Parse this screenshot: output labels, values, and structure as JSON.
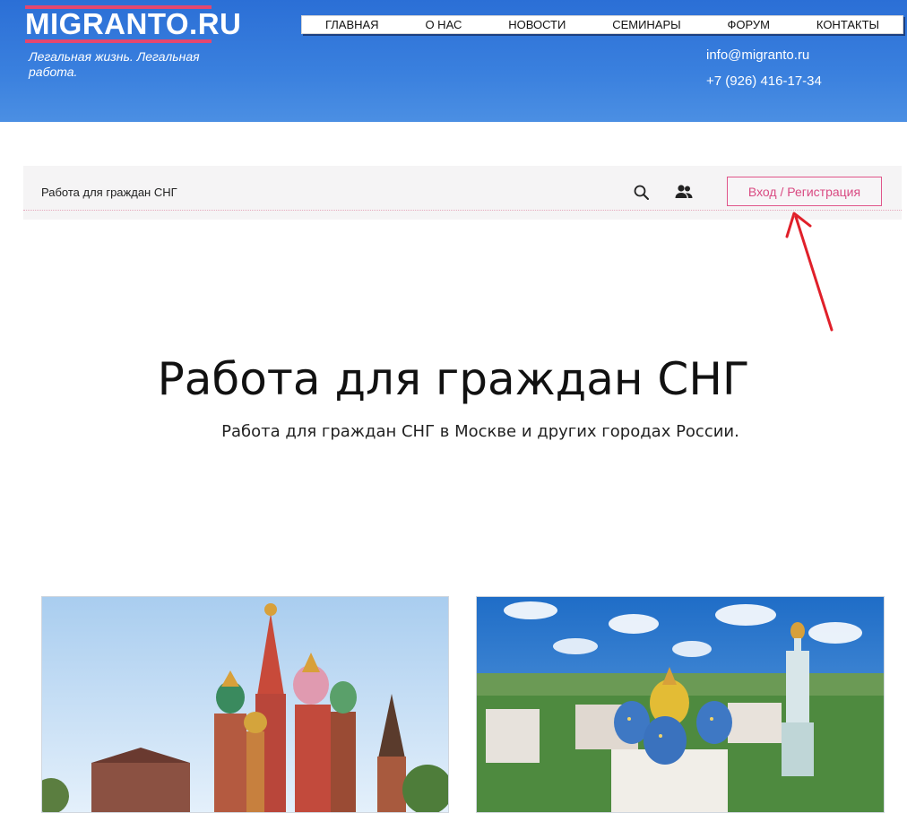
{
  "header": {
    "logo_text": "MIGRANTO.RU",
    "tagline": "Легальная жизнь. Легальная работа.",
    "nav": [
      "ГЛАВНАЯ",
      "О НАС",
      "НОВОСТИ",
      "СЕМИНАРЫ",
      "ФОРУМ",
      "КОНТАКТЫ"
    ],
    "email": "info@migranto.ru",
    "phone": "+7 (926) 416-17-34",
    "bg_color": "#2f74da",
    "accent_color": "#e4476f"
  },
  "sitebar": {
    "site_name": "Работа для граждан СНГ",
    "login_label": "Вход / Регистрация",
    "icons": [
      "search-icon",
      "user-icon"
    ]
  },
  "hero": {
    "title": "Работа для граждан СНГ",
    "subtitle": "Работа для граждан СНГ в Москве и других городах России."
  },
  "annotation_color": "#e0202a"
}
